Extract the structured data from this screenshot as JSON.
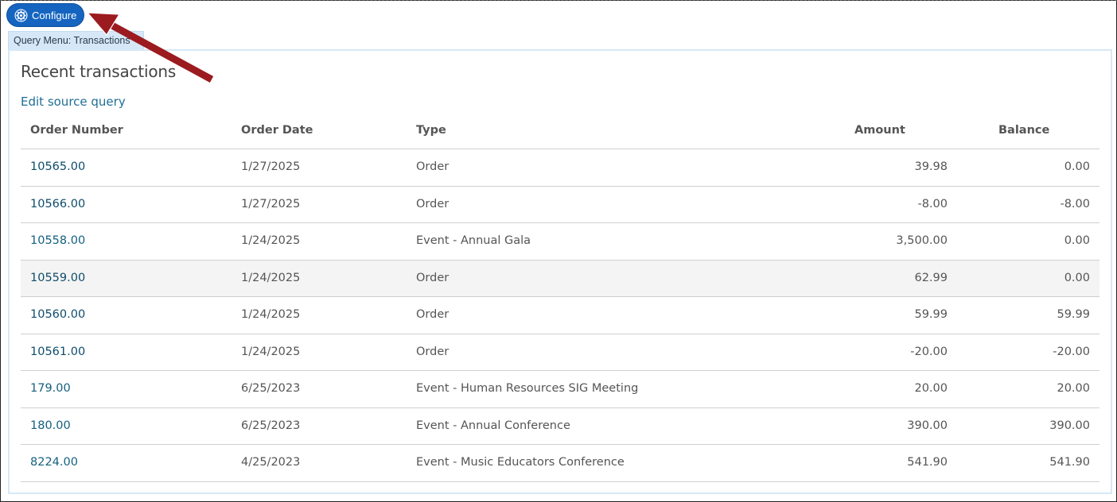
{
  "toolbar": {
    "configure_label": "Configure"
  },
  "query_tab": {
    "label": "Query Menu: Transactions"
  },
  "panel": {
    "title": "Recent transactions",
    "edit_link": "Edit source query"
  },
  "table": {
    "headers": {
      "order_number": "Order Number",
      "order_date": "Order Date",
      "type": "Type",
      "amount": "Amount",
      "balance": "Balance"
    },
    "rows": [
      {
        "order": "10565.00",
        "date": "1/27/2025",
        "type": "Order",
        "amount": "39.98",
        "balance": "0.00"
      },
      {
        "order": "10566.00",
        "date": "1/27/2025",
        "type": "Order",
        "amount": "-8.00",
        "balance": "-8.00"
      },
      {
        "order": "10558.00",
        "date": "1/24/2025",
        "type": "Event - Annual Gala",
        "amount": "3,500.00",
        "balance": "0.00"
      },
      {
        "order": "10559.00",
        "date": "1/24/2025",
        "type": "Order",
        "amount": "62.99",
        "balance": "0.00"
      },
      {
        "order": "10560.00",
        "date": "1/24/2025",
        "type": "Order",
        "amount": "59.99",
        "balance": "59.99"
      },
      {
        "order": "10561.00",
        "date": "1/24/2025",
        "type": "Order",
        "amount": "-20.00",
        "balance": "-20.00"
      },
      {
        "order": "179.00",
        "date": "6/25/2023",
        "type": "Event - Human Resources SIG Meeting",
        "amount": "20.00",
        "balance": "20.00"
      },
      {
        "order": "180.00",
        "date": "6/25/2023",
        "type": "Event - Annual Conference",
        "amount": "390.00",
        "balance": "390.00"
      },
      {
        "order": "8224.00",
        "date": "4/25/2023",
        "type": "Event - Music Educators Conference",
        "amount": "541.90",
        "balance": "541.90"
      }
    ]
  },
  "icons": {
    "configure": "gear-icon",
    "annotation": "arrow-annotation"
  },
  "colors": {
    "button": "#1565c0",
    "link": "#1f6e96",
    "tab": "#d6e8f7",
    "arrow": "#9b1b1f"
  }
}
